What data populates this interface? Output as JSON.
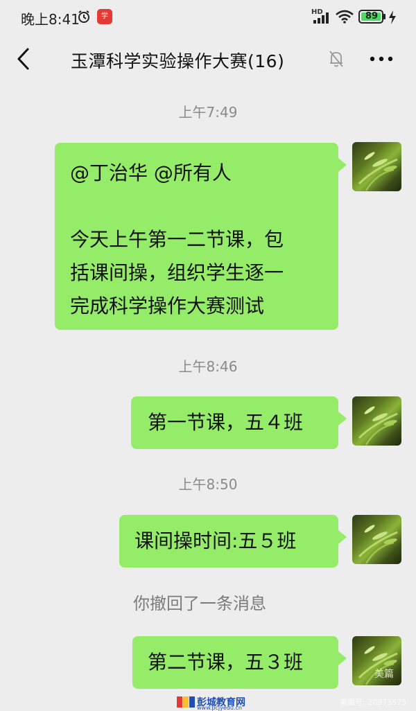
{
  "status_bar": {
    "time": "晚上8:41",
    "network": "HD",
    "battery": "89"
  },
  "header": {
    "title": "玉潭科学实验操作大赛(16)"
  },
  "messages": [
    {
      "timestamp": "上午7:49",
      "text_lines": [
        "@丁治华  @所有人",
        "",
        "今天上午第一二节课，包",
        "括课间操，组织学生逐一",
        "完成科学操作大赛测试"
      ]
    },
    {
      "timestamp": "上午8:46",
      "text": "第一节课，五４班"
    },
    {
      "timestamp": "上午8:50",
      "text": "课间操时间:五５班"
    },
    {
      "recall_notice": "你撤回了一条消息"
    },
    {
      "text": "第二节课，五３班"
    }
  ],
  "watermarks": {
    "site_name": "彭城教育网",
    "site_url": "www.pcjyedu.cn",
    "meipian": "美篇",
    "meipian_id": "美篇号: 20973575"
  },
  "colors": {
    "background": "#ededed",
    "bubble": "#95ec69",
    "timestamp": "#8a8a8a"
  }
}
